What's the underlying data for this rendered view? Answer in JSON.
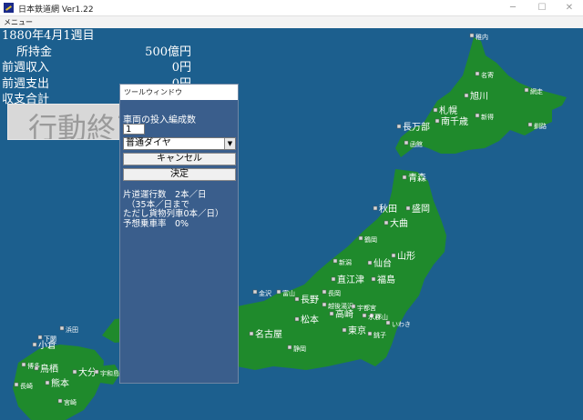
{
  "window": {
    "title": "日本鉄道網 Ver1.22"
  },
  "menubar": {
    "menu_label": "メニュー"
  },
  "stats": {
    "date": "1880年4月1週目",
    "rows": [
      {
        "label": "所持金",
        "value": "500億円"
      },
      {
        "label": "前週収入",
        "value": "0円"
      },
      {
        "label": "前週支出",
        "value": "0円"
      },
      {
        "label": "収支合計",
        "value": ""
      }
    ]
  },
  "action_button": {
    "label": "行動終了"
  },
  "tool_window": {
    "title": "ツールウィンドウ",
    "formation_label": "車両の投入編成数",
    "formation_value": "1",
    "diagram_select": "普通ダイヤ",
    "cancel_label": "キャンセル",
    "confirm_label": "決定",
    "info": [
      "片道運行数　2本／日",
      "（35本／日まで",
      "ただし貨物列車0本／日）",
      "予想乗車率　0%"
    ]
  },
  "map": {
    "sea_color": "#1c5f8e",
    "land_color": "#1f8a2c",
    "cities": [
      {
        "name": "稚内",
        "size": "s"
      },
      {
        "name": "名寄",
        "size": "s"
      },
      {
        "name": "旭川",
        "size": "l"
      },
      {
        "name": "網走",
        "size": "s"
      },
      {
        "name": "札幌",
        "size": "l"
      },
      {
        "name": "南千歳",
        "size": "l"
      },
      {
        "name": "新得",
        "size": "s"
      },
      {
        "name": "釧路",
        "size": "s"
      },
      {
        "name": "長万部",
        "size": "l"
      },
      {
        "name": "函館",
        "size": "s"
      },
      {
        "name": "青森",
        "size": "l"
      },
      {
        "name": "秋田",
        "size": "l"
      },
      {
        "name": "盛岡",
        "size": "l"
      },
      {
        "name": "大曲",
        "size": "l"
      },
      {
        "name": "鶴岡",
        "size": "s"
      },
      {
        "name": "山形",
        "size": "l"
      },
      {
        "name": "仙台",
        "size": "l"
      },
      {
        "name": "新潟",
        "size": "s"
      },
      {
        "name": "直江津",
        "size": "l"
      },
      {
        "name": "福島",
        "size": "l"
      },
      {
        "name": "金沢",
        "size": "s"
      },
      {
        "name": "富山",
        "size": "s"
      },
      {
        "name": "長岡",
        "size": "s"
      },
      {
        "name": "越後湯沢",
        "size": "s"
      },
      {
        "name": "郡山",
        "size": "s"
      },
      {
        "name": "いわき",
        "size": "s"
      },
      {
        "name": "長野",
        "size": "l"
      },
      {
        "name": "高崎",
        "size": "l"
      },
      {
        "name": "宇都宮",
        "size": "s"
      },
      {
        "name": "水戸",
        "size": "s"
      },
      {
        "name": "松本",
        "size": "l"
      },
      {
        "name": "東京",
        "size": "l"
      },
      {
        "name": "銚子",
        "size": "s"
      },
      {
        "name": "名古屋",
        "size": "l"
      },
      {
        "name": "静岡",
        "size": "s"
      },
      {
        "name": "浜田",
        "size": "s"
      },
      {
        "name": "下関",
        "size": "s"
      },
      {
        "name": "小倉",
        "size": "l"
      },
      {
        "name": "博多",
        "size": "s"
      },
      {
        "name": "鳥栖",
        "size": "l"
      },
      {
        "name": "大分",
        "size": "l"
      },
      {
        "name": "宇和島",
        "size": "s"
      },
      {
        "name": "長崎",
        "size": "s"
      },
      {
        "name": "熊本",
        "size": "l"
      },
      {
        "name": "宮崎",
        "size": "s"
      }
    ]
  }
}
